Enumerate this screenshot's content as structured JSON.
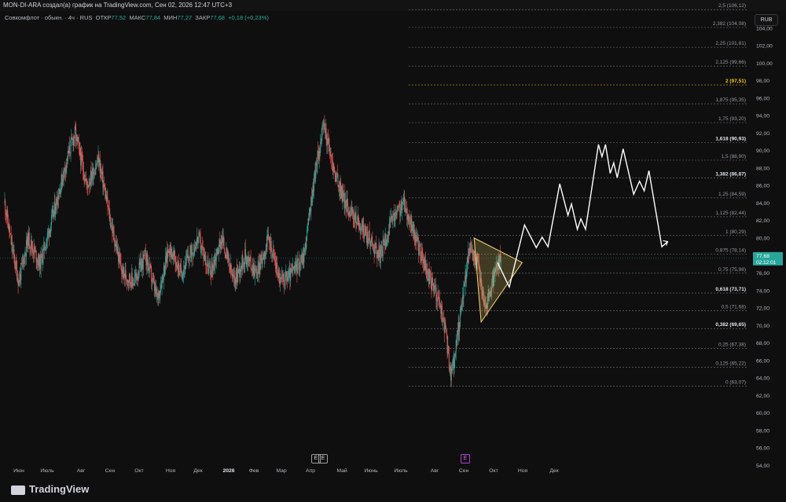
{
  "header": {
    "title": "MON-DI-ARA создал(а) график на TradingView.com, Сен 02, 2026 12:47 UTC+3"
  },
  "legend": {
    "symbol": "Совкомфлот · обыкн. · 4ч · RUS",
    "open_label": "ОТКР",
    "open": "77,52",
    "high_label": "МАКС",
    "high": "77,84",
    "low_label": "МИН",
    "low": "77,27",
    "close_label": "ЗАКР",
    "close": "77,68",
    "change": "+0,18 (+0,23%)"
  },
  "currency": "RUB",
  "price_marker": {
    "price": "77,68",
    "timer": "02:12:01",
    "color": "#26a69a"
  },
  "events": {
    "earnings_1": "E",
    "earnings_2": "E",
    "earnings_3": "E"
  },
  "branding": {
    "name": "TradingView"
  },
  "colors": {
    "up": "#26a69a",
    "down": "#ef5350",
    "fib_line": "#787b86",
    "fib_gold": "#f5c518",
    "triangle": "#f5d76e",
    "path": "#ffffff"
  },
  "chart_data": {
    "type": "candlestick",
    "y_axis": {
      "min": 53.5,
      "max": 106.5,
      "ticks": [
        104,
        102,
        100,
        98,
        96,
        94,
        92,
        90,
        88,
        86,
        84,
        82,
        80,
        78,
        76,
        74,
        72,
        70,
        68,
        66,
        64,
        62,
        60,
        58,
        56,
        54
      ],
      "tick_labels": [
        "104,00",
        "102,00",
        "100,00",
        "98,00",
        "96,00",
        "94,00",
        "92,00",
        "90,00",
        "88,00",
        "86,00",
        "84,00",
        "82,00",
        "80,00",
        "78,00",
        "76,00",
        "74,00",
        "72,00",
        "70,00",
        "68,00",
        "66,00",
        "64,00",
        "62,00",
        "60,00",
        "58,00",
        "56,00",
        "54,00"
      ]
    },
    "x_axis": {
      "labels": [
        "Июн",
        "Июль",
        "Авг",
        "Сен",
        "Окт",
        "Ноя",
        "Дек",
        "2026",
        "Фев",
        "Мар",
        "Апр",
        "Май",
        "Июнь",
        "Июль",
        "Авг",
        "Сен",
        "Окт",
        "Ноя",
        "Дек"
      ],
      "bold": "2026"
    },
    "price_series": [
      {
        "t": 0,
        "p": 84
      },
      {
        "t": 0.6,
        "p": 79
      },
      {
        "t": 1.2,
        "p": 75
      },
      {
        "t": 2,
        "p": 80
      },
      {
        "t": 3,
        "p": 77
      },
      {
        "t": 4,
        "p": 82
      },
      {
        "t": 5.5,
        "p": 90
      },
      {
        "t": 6,
        "p": 92
      },
      {
        "t": 7,
        "p": 86
      },
      {
        "t": 8,
        "p": 89
      },
      {
        "t": 9,
        "p": 82
      },
      {
        "t": 10,
        "p": 76
      },
      {
        "t": 11,
        "p": 75
      },
      {
        "t": 12,
        "p": 78
      },
      {
        "t": 13,
        "p": 73
      },
      {
        "t": 14,
        "p": 79
      },
      {
        "t": 15,
        "p": 76
      },
      {
        "t": 16.5,
        "p": 80
      },
      {
        "t": 17.5,
        "p": 76
      },
      {
        "t": 18.5,
        "p": 80
      },
      {
        "t": 19.5,
        "p": 75
      },
      {
        "t": 20.5,
        "p": 78
      },
      {
        "t": 21.5,
        "p": 76
      },
      {
        "t": 22.5,
        "p": 80
      },
      {
        "t": 23.5,
        "p": 75
      },
      {
        "t": 24.5,
        "p": 76
      },
      {
        "t": 25.5,
        "p": 78
      },
      {
        "t": 26.5,
        "p": 88
      },
      {
        "t": 27.2,
        "p": 93
      },
      {
        "t": 28,
        "p": 88
      },
      {
        "t": 29,
        "p": 84
      },
      {
        "t": 30,
        "p": 82
      },
      {
        "t": 31,
        "p": 80
      },
      {
        "t": 32,
        "p": 78
      },
      {
        "t": 33,
        "p": 82
      },
      {
        "t": 34,
        "p": 84
      },
      {
        "t": 35,
        "p": 80
      },
      {
        "t": 36,
        "p": 76
      },
      {
        "t": 37,
        "p": 73
      },
      {
        "t": 37.6,
        "p": 69
      },
      {
        "t": 38,
        "p": 64
      },
      {
        "t": 38.4,
        "p": 67
      },
      {
        "t": 39,
        "p": 73
      },
      {
        "t": 39.6,
        "p": 79
      },
      {
        "t": 40.3,
        "p": 77
      },
      {
        "t": 41,
        "p": 72
      },
      {
        "t": 41.6,
        "p": 75
      },
      {
        "t": 42.3,
        "p": 77.7
      }
    ],
    "fib_levels": [
      {
        "ratio": "2,5",
        "price": 106.12,
        "label": "2,5 (106,12)"
      },
      {
        "ratio": "2,382",
        "price": 104.08,
        "label": "2,382 (104,08)"
      },
      {
        "ratio": "2,25",
        "price": 101.81,
        "label": "2,25 (101,81)"
      },
      {
        "ratio": "2,125",
        "price": 99.66,
        "label": "2,125 (99,66)"
      },
      {
        "ratio": "2",
        "price": 97.51,
        "label": "2 (97,51)",
        "style": "gold"
      },
      {
        "ratio": "1,875",
        "price": 95.35,
        "label": "1,875 (95,35)"
      },
      {
        "ratio": "1,75",
        "price": 93.2,
        "label": "1,75 (93,20)"
      },
      {
        "ratio": "1,618",
        "price": 90.93,
        "label": "1,618 (90,93)",
        "style": "bold"
      },
      {
        "ratio": "1,5",
        "price": 88.9,
        "label": "1,5 (88,90)"
      },
      {
        "ratio": "1,382",
        "price": 86.87,
        "label": "1,382 (86,87)",
        "style": "bold"
      },
      {
        "ratio": "1,25",
        "price": 84.59,
        "label": "1,25 (84,59)"
      },
      {
        "ratio": "1,125",
        "price": 82.44,
        "label": "1,125 (82,44)"
      },
      {
        "ratio": "1",
        "price": 80.29,
        "label": "1 (80,29)"
      },
      {
        "ratio": "0,875",
        "price": 78.14,
        "label": "0,875 (78,14)"
      },
      {
        "ratio": "0,75",
        "price": 75.98,
        "label": "0,75 (75,98)"
      },
      {
        "ratio": "0,618",
        "price": 73.71,
        "label": "0,618 (73,71)",
        "style": "bold"
      },
      {
        "ratio": "0,5",
        "price": 71.68,
        "label": "0,5 (71,68)"
      },
      {
        "ratio": "0,382",
        "price": 69.65,
        "label": "0,382 (69,65)",
        "style": "bold"
      },
      {
        "ratio": "0,25",
        "price": 67.38,
        "label": "0,25 (67,38)"
      },
      {
        "ratio": "0,125",
        "price": 65.22,
        "label": "0,125 (65,22)"
      },
      {
        "ratio": "0",
        "price": 63.07,
        "label": "0 (63,07)"
      }
    ],
    "triangle": [
      {
        "t": 40.0,
        "p": 80.0
      },
      {
        "t": 44.1,
        "p": 77.2
      },
      {
        "t": 40.6,
        "p": 70.4
      }
    ],
    "forecast_path": [
      {
        "t": 42.0,
        "p": 77.2
      },
      {
        "t": 43.0,
        "p": 74.4
      },
      {
        "t": 44.3,
        "p": 81.5
      },
      {
        "t": 45.3,
        "p": 78.9
      },
      {
        "t": 45.8,
        "p": 80.1
      },
      {
        "t": 46.3,
        "p": 79.0
      },
      {
        "t": 47.3,
        "p": 86.2
      },
      {
        "t": 48.0,
        "p": 82.6
      },
      {
        "t": 48.3,
        "p": 83.9
      },
      {
        "t": 48.8,
        "p": 81.0
      },
      {
        "t": 49.1,
        "p": 82.2
      },
      {
        "t": 49.5,
        "p": 81.0
      },
      {
        "t": 50.6,
        "p": 90.7
      },
      {
        "t": 50.9,
        "p": 89.3
      },
      {
        "t": 51.2,
        "p": 90.7
      },
      {
        "t": 51.6,
        "p": 87.4
      },
      {
        "t": 51.9,
        "p": 88.6
      },
      {
        "t": 52.2,
        "p": 86.9
      },
      {
        "t": 52.7,
        "p": 90.2
      },
      {
        "t": 53.6,
        "p": 85.0
      },
      {
        "t": 54.1,
        "p": 86.5
      },
      {
        "t": 54.5,
        "p": 85.4
      },
      {
        "t": 54.9,
        "p": 87.7
      },
      {
        "t": 56.0,
        "p": 79.0
      },
      {
        "t": 56.5,
        "p": 79.6
      }
    ]
  }
}
